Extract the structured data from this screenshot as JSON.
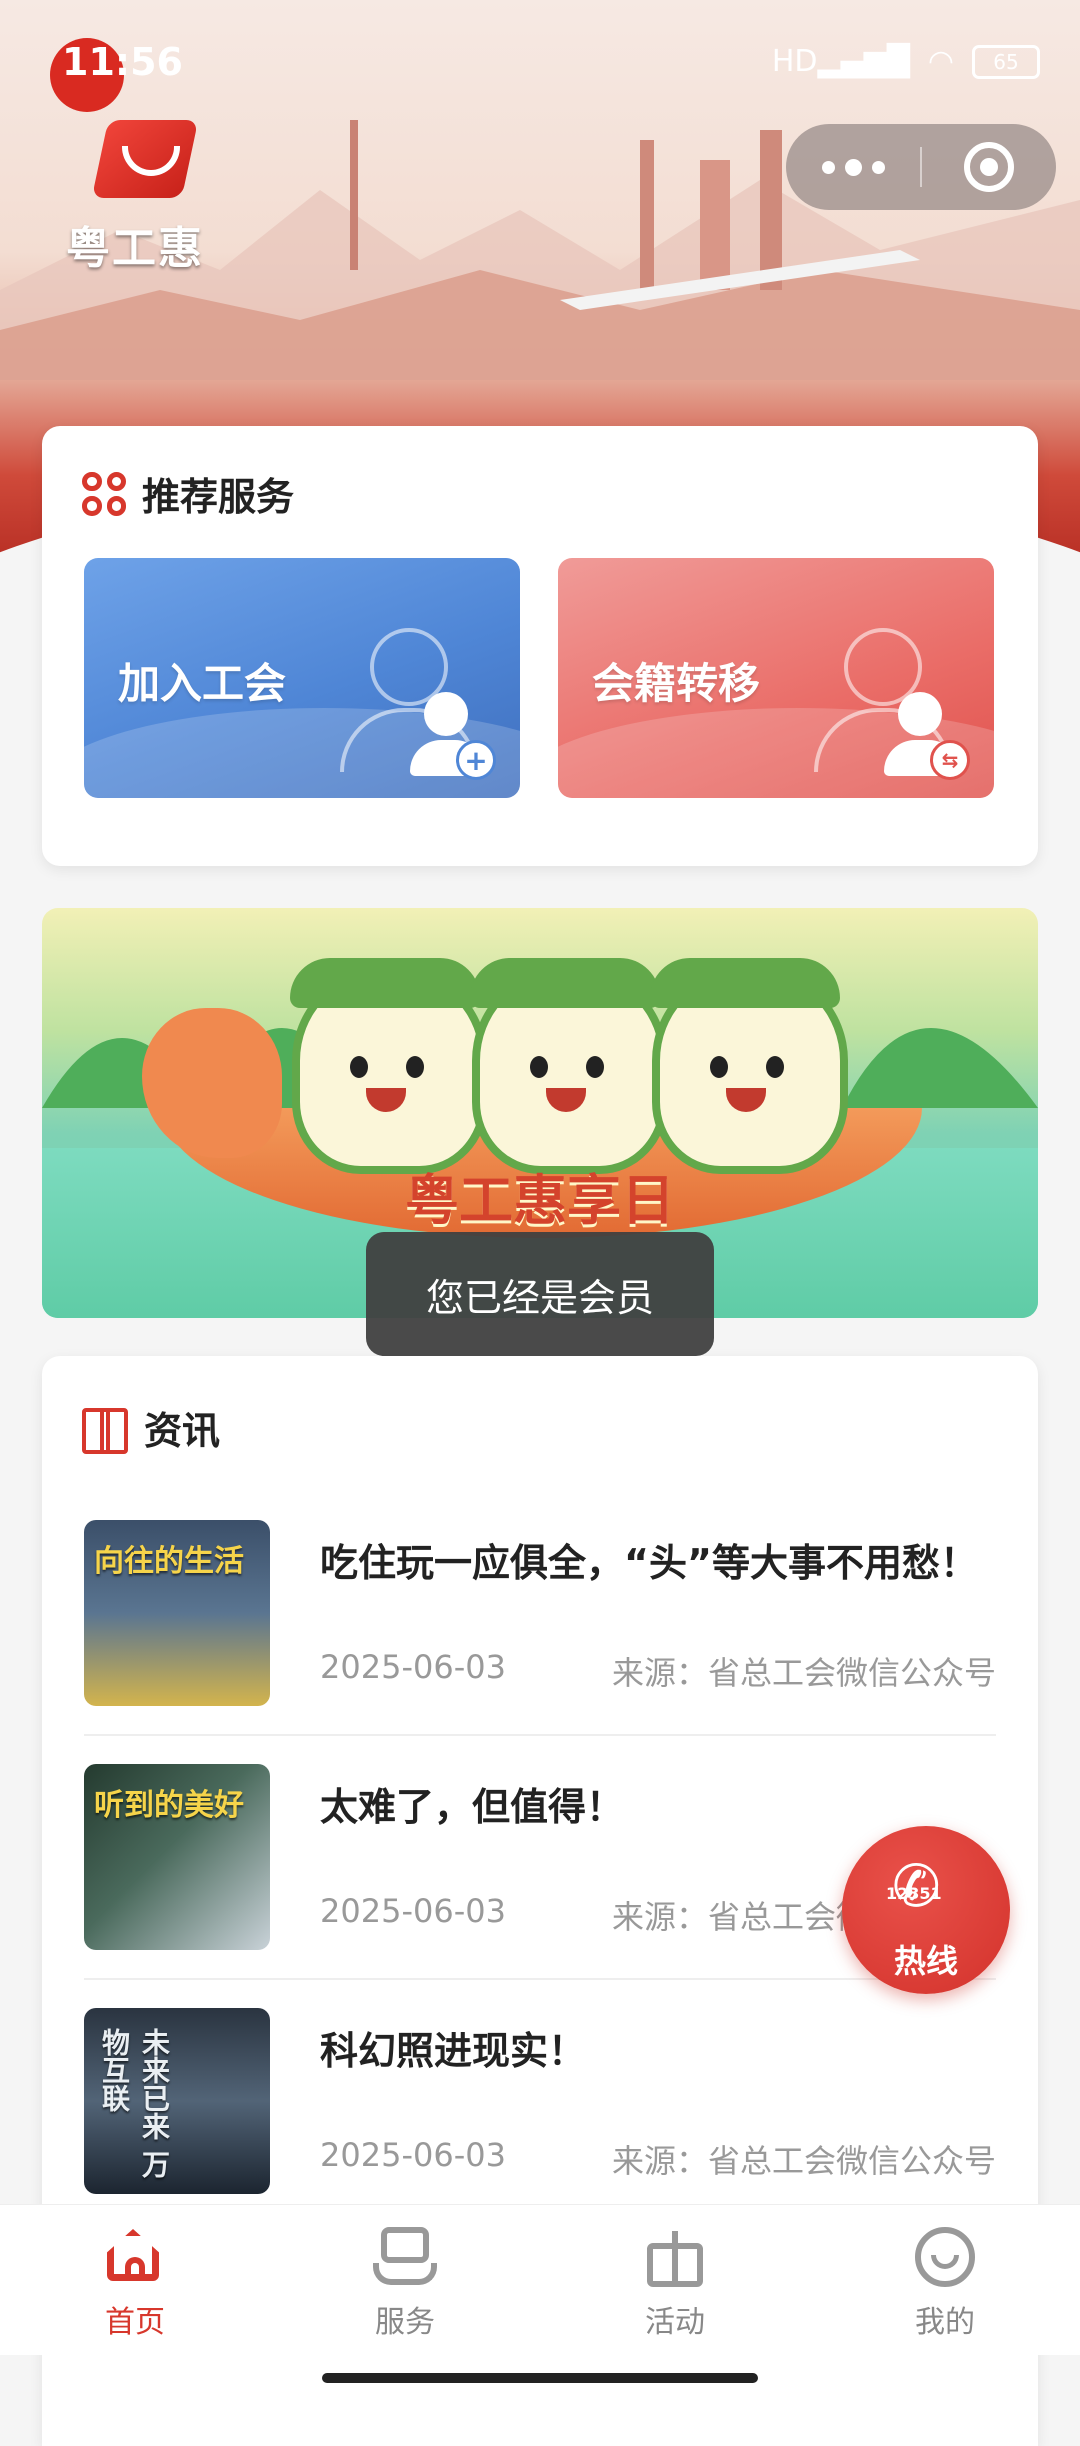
{
  "status_bar": {
    "time": "11:56",
    "network": "HD",
    "battery": "65"
  },
  "header": {
    "brand_name": "粤工惠"
  },
  "recommend": {
    "title": "推荐服务",
    "services": [
      {
        "label": "加入工会",
        "color": "#4f86d6"
      },
      {
        "label": "会籍转移",
        "color": "#e0524d"
      }
    ]
  },
  "banner": {
    "title": "粤工惠享日"
  },
  "toast": {
    "message": "您已经是会员"
  },
  "news": {
    "title": "资讯",
    "items": [
      {
        "title": "吃住玩一应俱全，“头”等大事不用愁！",
        "date": "2025-06-03",
        "source": "来源：省总工会微信公众号",
        "thumb_caption": "向往的生活"
      },
      {
        "title": "太难了，但值得！",
        "date": "2025-06-03",
        "source": "来源：省总工会微信公众号",
        "thumb_caption": "听到的美好"
      },
      {
        "title": "科幻照进现实！",
        "date": "2025-06-03",
        "source": "来源：省总工会微信公众号",
        "thumb_caption": "未来已来 万物互联"
      }
    ]
  },
  "hotline": {
    "number": "12351",
    "label": "热线"
  },
  "tabbar": {
    "tabs": [
      {
        "label": "首页",
        "icon": "home-icon",
        "active": true
      },
      {
        "label": "服务",
        "icon": "service-icon",
        "active": false
      },
      {
        "label": "活动",
        "icon": "gift-icon",
        "active": false
      },
      {
        "label": "我的",
        "icon": "profile-icon",
        "active": false
      }
    ]
  },
  "colors": {
    "accent": "#d7372c",
    "inactive": "#888888"
  }
}
